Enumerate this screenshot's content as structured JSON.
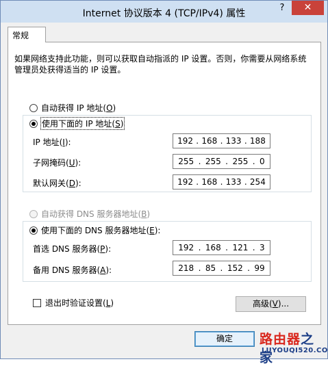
{
  "window": {
    "title": "Internet 协议版本 4 (TCP/IPv4) 属性",
    "help": "?",
    "close": "✕"
  },
  "tab": {
    "label": "常规"
  },
  "description": "如果网络支持此功能，则可以获取自动指派的 IP 设置。否则，你需要从网络系统管理员处获得适当的 IP 设置。",
  "ip": {
    "auto_label": "自动获得 IP 地址(",
    "auto_key": "O",
    "manual_label": "使用下面的 IP 地址(",
    "manual_key": "S",
    "selected": "manual",
    "fields": [
      {
        "label": "IP 地址(",
        "key": "I",
        "octets": [
          "192",
          "168",
          "133",
          "188"
        ]
      },
      {
        "label": "子网掩码(",
        "key": "U",
        "octets": [
          "255",
          "255",
          "255",
          "0"
        ]
      },
      {
        "label": "默认网关(",
        "key": "D",
        "octets": [
          "192",
          "168",
          "133",
          "254"
        ]
      }
    ]
  },
  "dns": {
    "auto_label": "自动获得 DNS 服务器地址(",
    "auto_key": "B",
    "manual_label": "使用下面的 DNS 服务器地址(",
    "manual_key": "E",
    "selected": "manual",
    "fields": [
      {
        "label": "首选 DNS 服务器(",
        "key": "P",
        "octets": [
          "192",
          "168",
          "121",
          "3"
        ]
      },
      {
        "label": "备用 DNS 服务器(",
        "key": "A",
        "octets": [
          "218",
          "85",
          "152",
          "99"
        ]
      }
    ]
  },
  "validate": {
    "label": "退出时验证设置(",
    "key": "L",
    "checked": false
  },
  "advanced": {
    "label": "高级(",
    "key": "V",
    "suffix": ")..."
  },
  "ok": {
    "label": "确定"
  },
  "watermark": {
    "brand_a": "路由器",
    "brand_b": "之家",
    "url": "LUYOUQI520.COM"
  }
}
